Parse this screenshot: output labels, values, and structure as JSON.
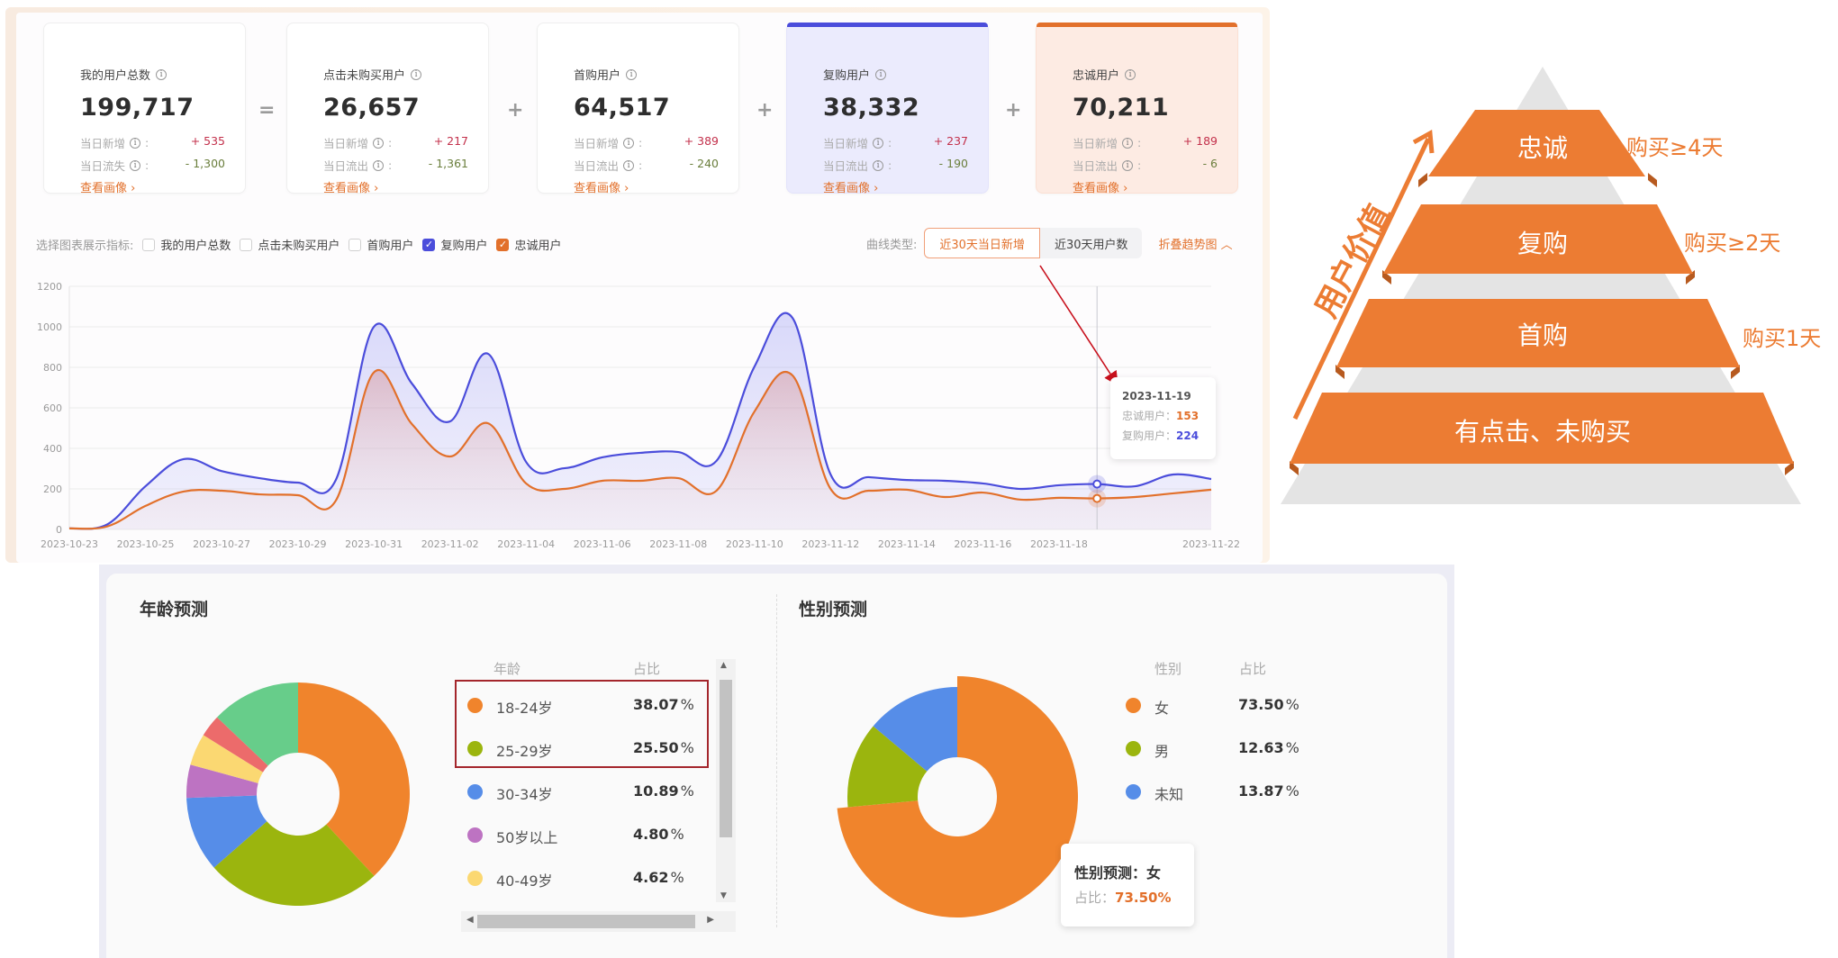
{
  "cards": [
    {
      "title": "我的用户总数",
      "value": "199,717",
      "row1_label": "当日新增",
      "row1_value": "+ 535",
      "row2_label": "当日流失",
      "row2_value": "- 1,300",
      "link": "查看画像 ›"
    },
    {
      "title": "点击未购买用户",
      "value": "26,657",
      "row1_label": "当日新增",
      "row1_value": "+ 217",
      "row2_label": "当日流出",
      "row2_value": "- 1,361",
      "link": "查看画像 ›"
    },
    {
      "title": "首购用户",
      "value": "64,517",
      "row1_label": "当日新增",
      "row1_value": "+ 389",
      "row2_label": "当日流出",
      "row2_value": "- 240",
      "link": "查看画像 ›"
    },
    {
      "title": "复购用户",
      "value": "38,332",
      "row1_label": "当日新增",
      "row1_value": "+ 237",
      "row2_label": "当日流出",
      "row2_value": "- 190",
      "link": "查看画像 ›"
    },
    {
      "title": "忠诚用户",
      "value": "70,211",
      "row1_label": "当日新增",
      "row1_value": "+ 189",
      "row2_label": "当日流出",
      "row2_value": "- 6",
      "link": "查看画像 ›"
    }
  ],
  "operators": [
    "=",
    "+",
    "+",
    "+"
  ],
  "info_glyph": "i",
  "colon": ":",
  "filter": {
    "label": "选择图表展示指标:",
    "options": [
      {
        "label": "我的用户总数",
        "checked": false
      },
      {
        "label": "点击未购买用户",
        "checked": false
      },
      {
        "label": "首购用户",
        "checked": false
      },
      {
        "label": "复购用户",
        "checked": true
      },
      {
        "label": "忠诚用户",
        "checked": true
      }
    ],
    "check_glyph": "✓"
  },
  "curve_type": {
    "label": "曲线类型:",
    "options": [
      "近30天当日新增",
      "近30天用户数"
    ],
    "selected": "近30天当日新增",
    "collapse_link": "折叠趋势图 ︿"
  },
  "colors": {
    "blue": "#4b4ddb",
    "orange": "#e2702b",
    "pyramid_orange": "#ec7c33",
    "pyramid_gray": "#e4e4e4",
    "annotation_red": "#c8111d"
  },
  "chart_data": {
    "type": "area",
    "title": "",
    "xlabel": "",
    "ylabel": "",
    "ylim": [
      0,
      1200
    ],
    "yticks": [
      0,
      200,
      400,
      600,
      800,
      1000,
      1200
    ],
    "grid": true,
    "x": [
      "2023-10-23",
      "2023-10-24",
      "2023-10-25",
      "2023-10-26",
      "2023-10-27",
      "2023-10-28",
      "2023-10-29",
      "2023-10-30",
      "2023-10-31",
      "2023-11-01",
      "2023-11-02",
      "2023-11-03",
      "2023-11-04",
      "2023-11-05",
      "2023-11-06",
      "2023-11-07",
      "2023-11-08",
      "2023-11-09",
      "2023-11-10",
      "2023-11-11",
      "2023-11-12",
      "2023-11-13",
      "2023-11-14",
      "2023-11-15",
      "2023-11-16",
      "2023-11-17",
      "2023-11-18",
      "2023-11-19",
      "2023-11-20",
      "2023-11-21",
      "2023-11-22"
    ],
    "xtick_labels": [
      "2023-10-23",
      "2023-10-25",
      "2023-10-27",
      "2023-10-29",
      "2023-10-31",
      "2023-11-02",
      "2023-11-04",
      "2023-11-06",
      "2023-11-08",
      "2023-11-10",
      "2023-11-12",
      "2023-11-14",
      "2023-11-16",
      "2023-11-18",
      "2023-11-22"
    ],
    "series": [
      {
        "name": "复购用户",
        "color": "#4b4ddb",
        "values": [
          5,
          25,
          213,
          347,
          288,
          253,
          231,
          244,
          1000,
          720,
          533,
          867,
          333,
          302,
          356,
          378,
          382,
          338,
          804,
          1044,
          271,
          258,
          244,
          240,
          227,
          200,
          218,
          224,
          213,
          271,
          249
        ]
      },
      {
        "name": "忠诚用户",
        "color": "#e2702b",
        "values": [
          5,
          15,
          116,
          187,
          191,
          173,
          169,
          142,
          775,
          520,
          360,
          524,
          227,
          200,
          240,
          240,
          253,
          191,
          582,
          760,
          200,
          191,
          196,
          160,
          182,
          147,
          156,
          153,
          160,
          178,
          196
        ]
      }
    ],
    "tooltip": {
      "date": "2023-11-19",
      "rows": [
        {
          "label": "忠诚用户：",
          "value": "153"
        },
        {
          "label": "复购用户：",
          "value": "224"
        }
      ]
    }
  },
  "pyramid": {
    "axis_label": "用户价值",
    "levels": [
      {
        "label": "忠诚",
        "note": "购买≥4天"
      },
      {
        "label": "复购",
        "note": "购买≥2天"
      },
      {
        "label": "首购",
        "note": "购买1天"
      },
      {
        "label": "有点击、未购买",
        "note": ""
      }
    ]
  },
  "age": {
    "title": "年龄预测",
    "col_name": "年龄",
    "col_pct": "占比",
    "pct_sign": "%",
    "items": [
      {
        "label": "18-24岁",
        "pct": "38.07",
        "value": 38.07,
        "color": "#f0842c"
      },
      {
        "label": "25-29岁",
        "pct": "25.50",
        "value": 25.5,
        "color": "#9bb50e"
      },
      {
        "label": "30-34岁",
        "pct": "10.89",
        "value": 10.89,
        "color": "#568de8"
      },
      {
        "label": "50岁以上",
        "pct": "4.80",
        "value": 4.8,
        "color": "#bd73c2"
      },
      {
        "label": "40-49岁",
        "pct": "4.62",
        "value": 4.62,
        "color": "#fbd872"
      }
    ],
    "hidden_slices": [
      {
        "value": 3.2,
        "color": "#ec6b6b"
      },
      {
        "value": 12.92,
        "color": "#67cd8a"
      }
    ],
    "scroll_up": "▲",
    "scroll_down": "▼",
    "scroll_left": "◀",
    "scroll_right": "▶"
  },
  "gender": {
    "title": "性别预测",
    "col_name": "性别",
    "col_pct": "占比",
    "pct_sign": "%",
    "items": [
      {
        "label": "女",
        "pct": "73.50",
        "value": 73.5,
        "color": "#f0842c"
      },
      {
        "label": "男",
        "pct": "12.63",
        "value": 12.63,
        "color": "#9bb50e"
      },
      {
        "label": "未知",
        "pct": "13.87",
        "value": 13.87,
        "color": "#568de8"
      }
    ],
    "tooltip": {
      "title": "性别预测：女",
      "label": "占比：",
      "value": "73.50%"
    }
  }
}
